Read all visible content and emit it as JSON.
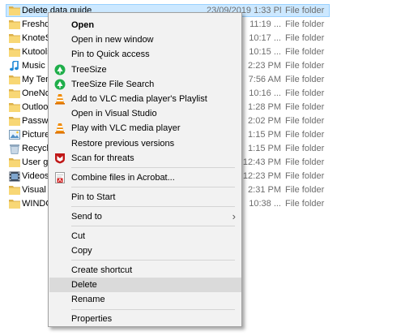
{
  "colors": {
    "selection": "#cce8ff",
    "menu_bg": "#f2f2f2",
    "menu_hover": "#dadada",
    "muted_text": "#6d6d6d"
  },
  "files": [
    {
      "name": "Delete data guide",
      "date": "23/09/2019 1:33 PM",
      "type": "File folder",
      "icon": "folder-icon",
      "selected": true
    },
    {
      "name": "Freshdesk",
      "date": "11:19 ...",
      "type": "File folder",
      "icon": "folder-icon"
    },
    {
      "name": "KnoteStore",
      "date": "10:17 ...",
      "type": "File folder",
      "icon": "folder-icon"
    },
    {
      "name": "Kutools",
      "date": "10:15 ...",
      "type": "File folder",
      "icon": "folder-icon"
    },
    {
      "name": "Music",
      "date": "2:23 PM",
      "type": "File folder",
      "icon": "music-note-icon"
    },
    {
      "name": "My Templates",
      "date": "7:56 AM",
      "type": "File folder",
      "icon": "folder-icon"
    },
    {
      "name": "OneNote",
      "date": "10:16 ...",
      "type": "File folder",
      "icon": "folder-icon"
    },
    {
      "name": "Outlook",
      "date": "1:28 PM",
      "type": "File folder",
      "icon": "folder-icon"
    },
    {
      "name": "Passwords",
      "date": "2:02 PM",
      "type": "File folder",
      "icon": "folder-icon"
    },
    {
      "name": "Pictures",
      "date": "1:15 PM",
      "type": "File folder",
      "icon": "pictures-icon"
    },
    {
      "name": "Recycle Bin",
      "date": "1:15 PM",
      "type": "File folder",
      "icon": "recycle-bin-icon"
    },
    {
      "name": "User guides",
      "date": "12:43 PM",
      "type": "File folder",
      "icon": "folder-icon"
    },
    {
      "name": "Videos",
      "date": "12:23 PM",
      "type": "File folder",
      "icon": "videos-icon"
    },
    {
      "name": "Visual Studio",
      "date": "2:31 PM",
      "type": "File folder",
      "icon": "folder-icon"
    },
    {
      "name": "WINDOWS",
      "date": "10:38 ...",
      "type": "File folder",
      "icon": "folder-icon"
    }
  ],
  "context_menu": {
    "items": [
      {
        "label": "Open",
        "bold": true
      },
      {
        "label": "Open in new window"
      },
      {
        "label": "Pin to Quick access"
      },
      {
        "label": "TreeSize",
        "icon": "treesize-icon"
      },
      {
        "label": "TreeSize File Search",
        "icon": "treesize-search-icon"
      },
      {
        "label": "Add to VLC media player's Playlist",
        "icon": "vlc-cone-icon"
      },
      {
        "label": "Open in Visual Studio"
      },
      {
        "label": "Play with VLC media player",
        "icon": "vlc-cone-icon"
      },
      {
        "label": "Restore previous versions"
      },
      {
        "label": "Scan for threats",
        "icon": "mcafee-shield-icon"
      },
      {
        "separator": true
      },
      {
        "label": "Combine files in Acrobat...",
        "icon": "acrobat-icon"
      },
      {
        "separator": true
      },
      {
        "label": "Pin to Start"
      },
      {
        "separator": true
      },
      {
        "label": "Send to",
        "submenu": true
      },
      {
        "separator": true
      },
      {
        "label": "Cut"
      },
      {
        "label": "Copy"
      },
      {
        "separator": true
      },
      {
        "label": "Create shortcut"
      },
      {
        "label": "Delete",
        "hover": true
      },
      {
        "label": "Rename"
      },
      {
        "separator": true
      },
      {
        "label": "Properties"
      }
    ]
  }
}
